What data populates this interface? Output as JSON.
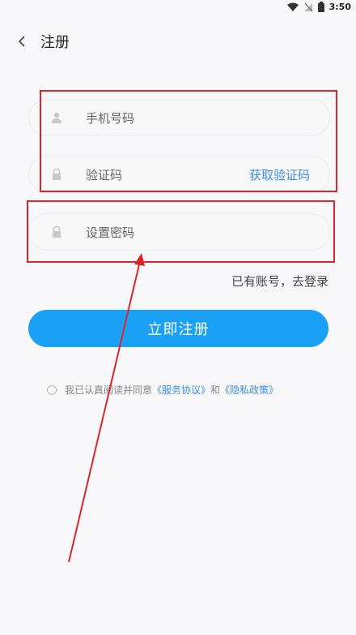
{
  "status_bar": {
    "time": "3:50"
  },
  "header": {
    "back_label": "<",
    "title": "注册"
  },
  "form": {
    "phone_placeholder": "手机号码",
    "code_placeholder": "验证码",
    "get_code_label": "获取验证码",
    "password_placeholder": "设置密码"
  },
  "login_link": "已有账号，去登录",
  "register_button": "立即注册",
  "agreement": {
    "prefix": "我已认真阅读并同意",
    "service_link": "《服务协议》",
    "and": "和",
    "privacy_link": "《隐私政策》"
  },
  "colors": {
    "accent": "#1aa1f5",
    "link": "#3a8ee6",
    "annotation": "#d9262c"
  }
}
